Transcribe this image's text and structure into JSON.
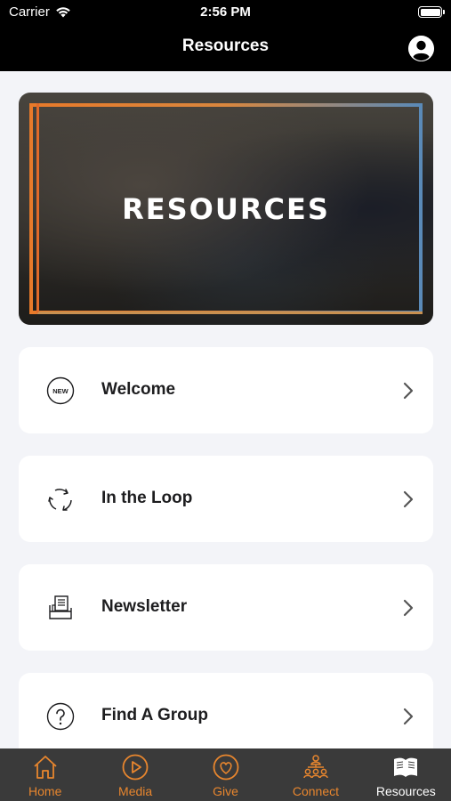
{
  "status_bar": {
    "carrier": "Carrier",
    "time": "2:56 PM"
  },
  "nav": {
    "title": "Resources",
    "profile_icon": "person-circle-icon"
  },
  "banner": {
    "title": "RESOURCES"
  },
  "menu": [
    {
      "label": "Welcome",
      "icon": "new-badge-icon"
    },
    {
      "label": "In the Loop",
      "icon": "loop-arrows-icon"
    },
    {
      "label": "Newsletter",
      "icon": "newsletter-icon"
    },
    {
      "label": "Find A Group",
      "icon": "question-circle-icon"
    }
  ],
  "welcome_icon_text": "NEW",
  "tabs": [
    {
      "label": "Home",
      "icon": "home-icon",
      "active": false
    },
    {
      "label": "Media",
      "icon": "play-circle-icon",
      "active": false
    },
    {
      "label": "Give",
      "icon": "heart-circle-icon",
      "active": false
    },
    {
      "label": "Connect",
      "icon": "people-network-icon",
      "active": false
    },
    {
      "label": "Resources",
      "icon": "book-icon",
      "active": true
    }
  ],
  "colors": {
    "accent": "#e8862e",
    "header_bg": "#000000",
    "tabbar_bg": "#3a3a3a",
    "page_bg": "#f3f4f8"
  }
}
